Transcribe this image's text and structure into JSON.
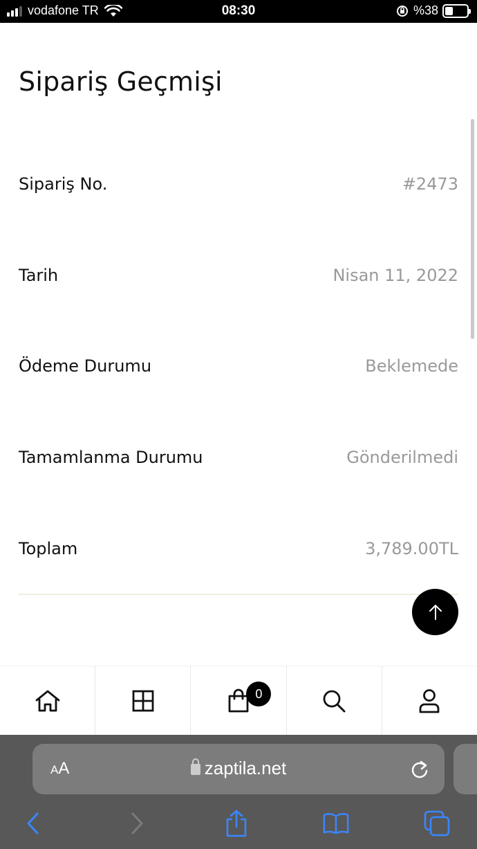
{
  "status_bar": {
    "carrier": "vodafone TR",
    "time": "08:30",
    "battery": "%38",
    "battery_level": 0.38
  },
  "page": {
    "title": "Sipariş Geçmişi",
    "rows": [
      {
        "label": "Sipariş No.",
        "value": "#2473"
      },
      {
        "label": "Tarih",
        "value": "Nisan 11, 2022"
      },
      {
        "label": "Ödeme Durumu",
        "value": "Beklemede"
      },
      {
        "label": "Tamamlanma Durumu",
        "value": "Gönderilmedi"
      },
      {
        "label": "Toplam",
        "value": "3,789.00TL"
      }
    ]
  },
  "bottom_nav": {
    "items": [
      "home-icon",
      "grid-icon",
      "shopping-bag-icon",
      "search-icon",
      "user-icon"
    ],
    "cart_count": "0"
  },
  "safari": {
    "aa_small": "A",
    "aa_big": "A",
    "url": "zaptila.net"
  },
  "colors": {
    "label": "#111111",
    "value": "#999999",
    "safari_bg": "#585858",
    "safari_accent": "#3a86ff"
  }
}
